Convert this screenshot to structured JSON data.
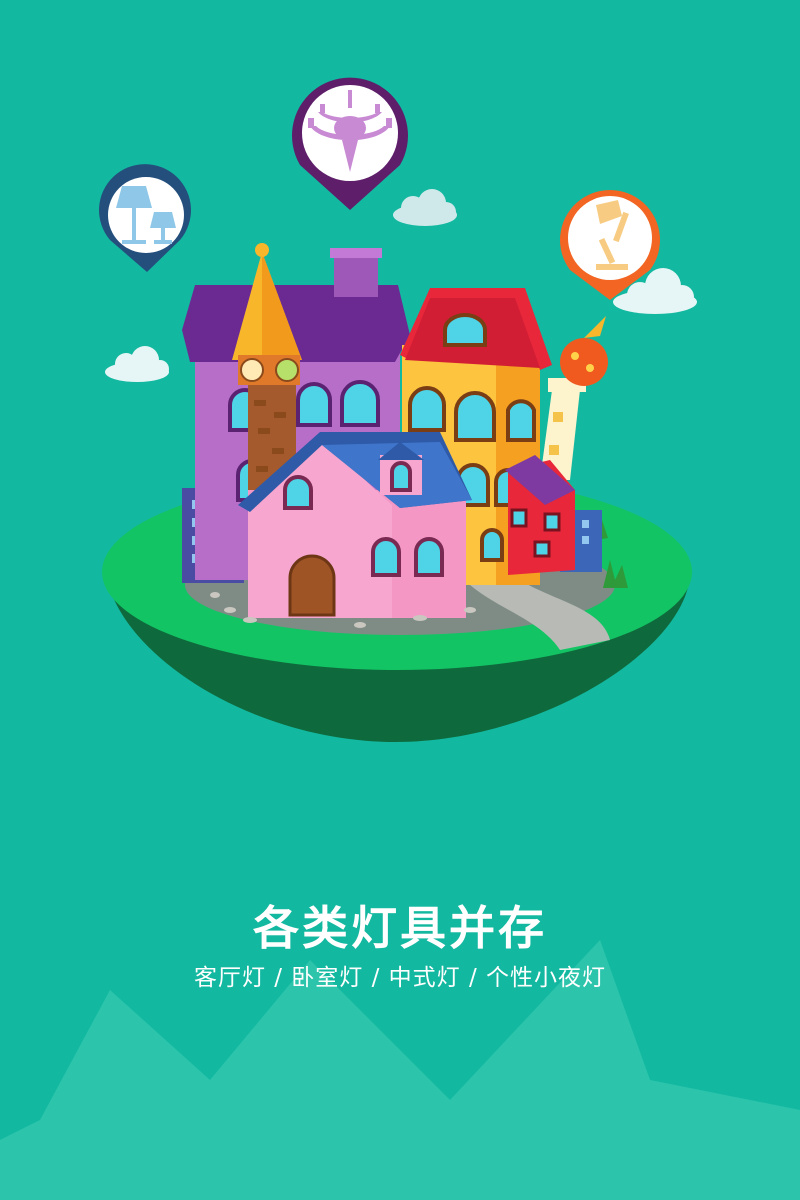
{
  "headline": "各类灯具并存",
  "subtitle": "客厅灯 / 卧室灯 / 中式灯 / 个性小夜灯",
  "colors": {
    "background": "#13b8a0",
    "mountains": "#2cc5ac",
    "island_top": "#12c463",
    "island_bottom": "#0e6a3c",
    "pin_left_ring": "#244f7d",
    "pin_center_ring": "#5e1e6a",
    "pin_right_ring": "#f26522"
  },
  "icons": {
    "pin_left": "table-lamps-icon",
    "pin_center": "chandelier-icon",
    "pin_right": "desk-lamp-icon"
  }
}
